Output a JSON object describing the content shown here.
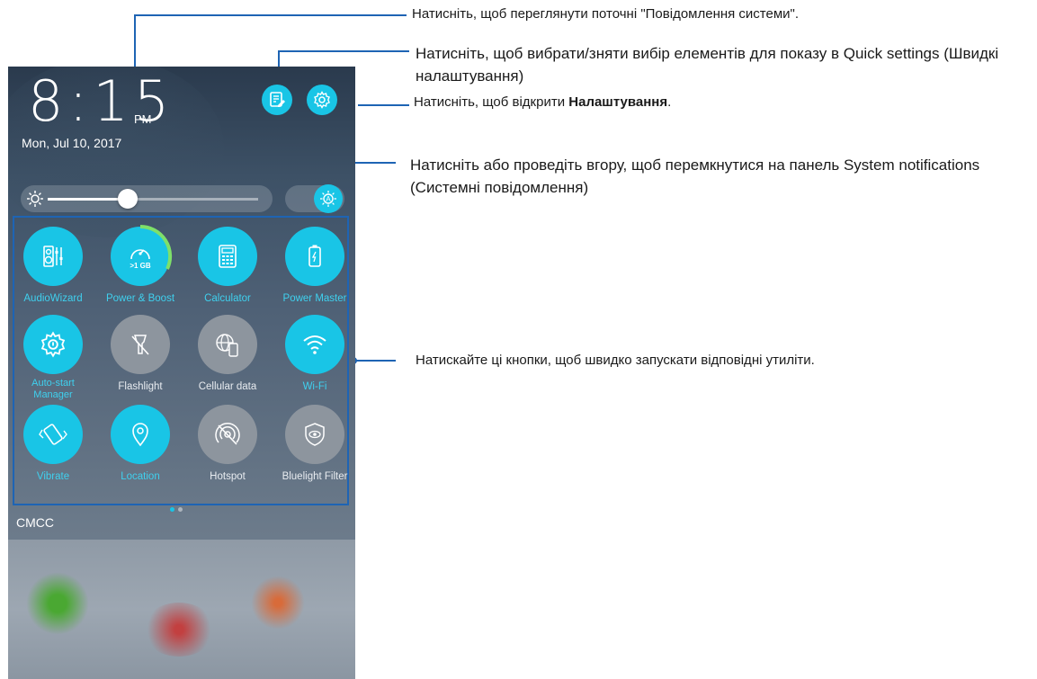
{
  "status": {
    "time": "8:15",
    "ampm": "PM",
    "date": "Mon, Jul 10, 2017",
    "carrier": "CMCC"
  },
  "header_buttons": [
    {
      "icon": "edit-notes-icon"
    },
    {
      "icon": "gear-icon"
    }
  ],
  "brightness": {
    "level_percent": 38,
    "auto_icon": "auto-brightness-icon"
  },
  "tiles": [
    {
      "label": "AudioWizard",
      "state": "on",
      "icon": "audiowizard-icon"
    },
    {
      "label": "Power & Boost",
      "state": "on",
      "icon": "speedometer-icon",
      "sublabel": ">1 GB"
    },
    {
      "label": "Calculator",
      "state": "on",
      "icon": "calculator-icon"
    },
    {
      "label": "Power Master",
      "state": "on",
      "icon": "battery-icon"
    },
    {
      "label": "Auto-start Manager",
      "state": "on",
      "icon": "auto-start-gear-icon"
    },
    {
      "label": "Flashlight",
      "state": "off",
      "icon": "flashlight-off-icon"
    },
    {
      "label": "Cellular data",
      "state": "off",
      "icon": "cellular-data-icon"
    },
    {
      "label": "Wi-Fi",
      "state": "on",
      "icon": "wifi-icon"
    },
    {
      "label": "Vibrate",
      "state": "on",
      "icon": "vibrate-icon"
    },
    {
      "label": "Location",
      "state": "on",
      "icon": "location-pin-icon"
    },
    {
      "label": "Hotspot",
      "state": "off",
      "icon": "hotspot-off-icon"
    },
    {
      "label": "Bluelight Filter",
      "state": "off",
      "icon": "bluelight-filter-icon"
    }
  ],
  "page_indicator": {
    "current": 1,
    "total": 2
  },
  "callouts": {
    "notifications": "Натисніть, щоб переглянути поточні \"Повідомлення системи\".",
    "quick_settings": "Натисніть, щоб вибрати/зняти вибір елементів для показу в Quick settings (Швидкі налаштування)",
    "settings_prefix": "Натисніть, щоб відкрити ",
    "settings_bold": "Налаштування",
    "settings_suffix": ".",
    "swipe": "Натисніть або проведіть вгору, щоб перемкнутися на панель System notifications (Системні повідомлення)",
    "buttons": "Натискайте ці кнопки, щоб швидко запускати відповідні утиліти."
  },
  "colors": {
    "accent": "#19c5e6",
    "callout_line": "#1e64b4"
  }
}
